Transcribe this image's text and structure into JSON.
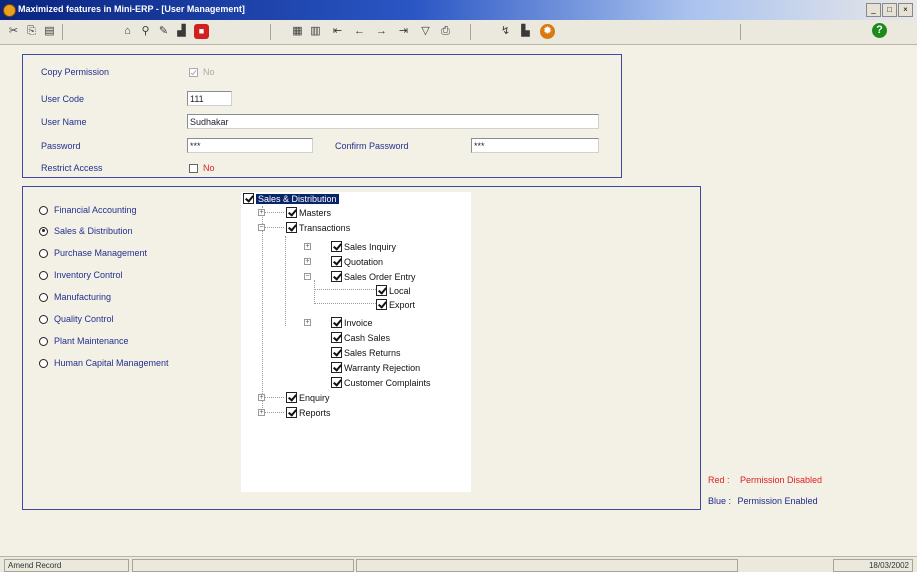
{
  "window": {
    "title": "Maximized features in Mini-ERP - [User Management]",
    "controls": [
      "_",
      "□",
      "×"
    ]
  },
  "toolbar": {
    "icons": [
      "cut-icon",
      "copy-icon",
      "paste-icon",
      "open-icon",
      "find-icon",
      "edit-icon",
      "chart-icon",
      "stop-icon",
      "save-icon",
      "grid-icon",
      "first-icon",
      "prev-icon",
      "next-icon",
      "last-icon",
      "filter-icon",
      "print-icon",
      "tools-icon",
      "report-icon",
      "gear-icon",
      "help-icon"
    ]
  },
  "form": {
    "copy_permission_label": "Copy Permission",
    "copy_permission_value": "No",
    "user_code_label": "User Code",
    "user_code_value": "111",
    "user_name_label": "User Name",
    "user_name_value": "Sudhakar",
    "password_label": "Password",
    "password_value": "***",
    "confirm_password_label": "Confirm Password",
    "confirm_password_value": "***",
    "restrict_access_label": "Restrict Access",
    "restrict_access_value": "No"
  },
  "modules": [
    {
      "label": "Financial Accounting",
      "selected": false
    },
    {
      "label": "Sales & Distribution",
      "selected": true
    },
    {
      "label": "Purchase Management",
      "selected": false
    },
    {
      "label": "Inventory Control",
      "selected": false
    },
    {
      "label": "Manufacturing",
      "selected": false
    },
    {
      "label": "Quality Control",
      "selected": false
    },
    {
      "label": "Plant Maintenance",
      "selected": false
    },
    {
      "label": "Human Capital Management",
      "selected": false
    }
  ],
  "tree": {
    "root": "Sales & Distribution",
    "masters": "Masters",
    "transactions": "Transactions",
    "sales_inquiry": "Sales Inquiry",
    "quotation": "Quotation",
    "sales_order_entry": "Sales Order Entry",
    "local": "Local",
    "export": "Export",
    "invoice": "Invoice",
    "cash_sales": "Cash Sales",
    "sales_returns": "Sales Returns",
    "warranty_rejection": "Warranty Rejection",
    "customer_complaints": "Customer Complaints",
    "enquiry": "Enquiry",
    "reports": "Reports"
  },
  "legend": {
    "red_key": "Red :",
    "red_text": "Permission Disabled",
    "blue_key": "Blue :",
    "blue_text": "Permission Enabled"
  },
  "status": {
    "left": "Amend Record",
    "right": "18/03/2002"
  },
  "colors": {
    "title_start": "#0a2480",
    "form_border": "#3f4aa0",
    "label_blue": "#23308e",
    "red": "#e02020",
    "selection": "#0a246a",
    "background": "#f3f0e6"
  }
}
